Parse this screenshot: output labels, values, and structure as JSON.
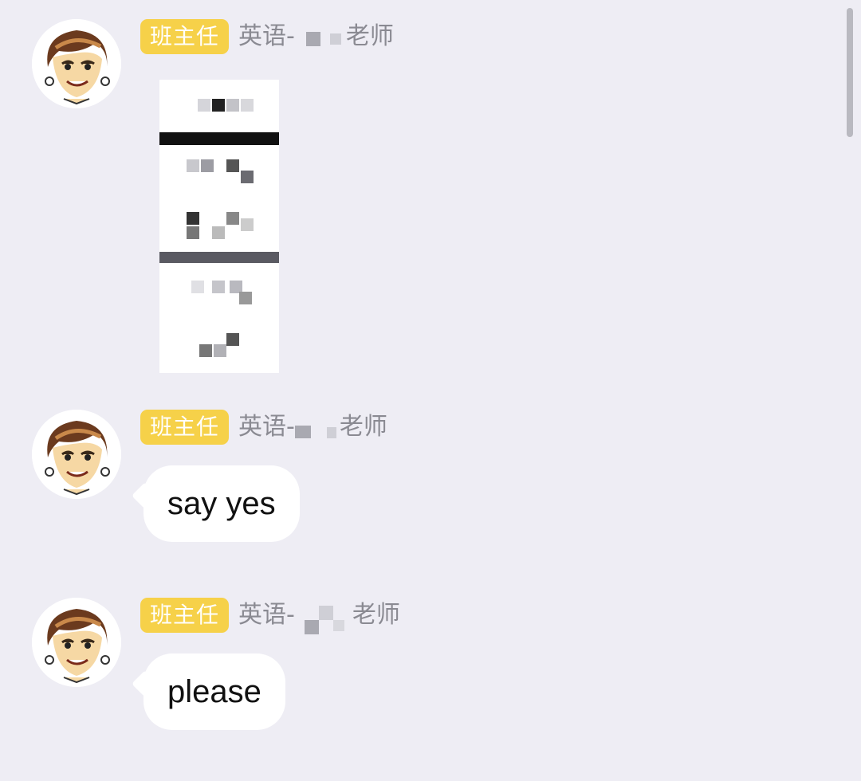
{
  "messages": [
    {
      "role_badge": "班主任",
      "sender_prefix": "英语-",
      "sender_suffix": "老师",
      "type": "image"
    },
    {
      "role_badge": "班主任",
      "sender_prefix": "英语-",
      "sender_suffix": "老师",
      "type": "text",
      "text": "say yes"
    },
    {
      "role_badge": "班主任",
      "sender_prefix": "英语-",
      "sender_suffix": "老师",
      "type": "text",
      "text": "please"
    }
  ],
  "colors": {
    "background": "#eeedf4",
    "badge": "#f6d149",
    "bubble": "#ffffff",
    "sender_text": "#8a8a92"
  }
}
